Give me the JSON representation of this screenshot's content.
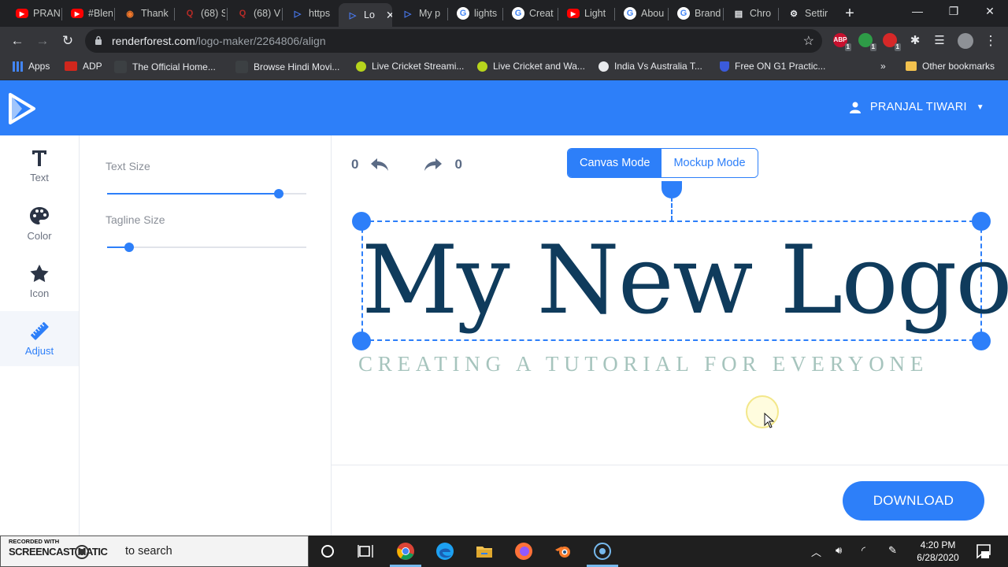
{
  "browser": {
    "tabs": [
      {
        "label": "PRAN",
        "icon": "youtube-icon",
        "color": "#ff0000"
      },
      {
        "label": "#Blen",
        "icon": "youtube-icon",
        "color": "#ff0000"
      },
      {
        "label": "Thank",
        "icon": "blender-icon",
        "color": "#f5792a"
      },
      {
        "label": "(68) S",
        "icon": "quora-icon",
        "color": "#b92b27"
      },
      {
        "label": "(68) V",
        "icon": "quora-icon",
        "color": "#b92b27"
      },
      {
        "label": "https",
        "icon": "renderforest-icon",
        "color": "#4a7cf7"
      },
      {
        "label": "Lo",
        "icon": "renderforest-icon",
        "color": "#4a7cf7"
      },
      {
        "label": "My p",
        "icon": "renderforest-icon",
        "color": "#4a7cf7"
      },
      {
        "label": "lights",
        "icon": "google-icon",
        "color": "#ffffff"
      },
      {
        "label": "Creat",
        "icon": "google-icon",
        "color": "#ffffff"
      },
      {
        "label": "Light",
        "icon": "youtube-icon",
        "color": "#ff0000"
      },
      {
        "label": "Abou",
        "icon": "google-icon",
        "color": "#ffffff"
      },
      {
        "label": "Brand",
        "icon": "google-icon",
        "color": "#ffffff"
      },
      {
        "label": "Chro",
        "icon": "store-icon",
        "color": "#e8eaed"
      },
      {
        "label": "Settir",
        "icon": "settings-gear-icon",
        "color": "#e8eaed"
      }
    ],
    "active_tab_index": 6,
    "url_domain": "renderforest.com",
    "url_path": "/logo-maker/2264806/align",
    "bookmarks": [
      {
        "label": "Apps",
        "icon": "apps-grid-icon"
      },
      {
        "label": "ADP",
        "icon": "adp-icon"
      },
      {
        "label": "The Official Home...",
        "icon": "site-icon"
      },
      {
        "label": "Browse Hindi Movi...",
        "icon": "site-icon"
      },
      {
        "label": "Live Cricket Streami...",
        "icon": "cricket-ball-icon"
      },
      {
        "label": "Live Cricket and Wa...",
        "icon": "cricket-ball-icon"
      },
      {
        "label": "India Vs Australia T...",
        "icon": "globe-icon"
      },
      {
        "label": "Free ON G1 Practic...",
        "icon": "shield-icon"
      }
    ],
    "more_bookmarks": "»",
    "other_bookmarks": "Other bookmarks",
    "extensions": [
      {
        "label": "ABP",
        "badge": "1",
        "color": "#c8102e"
      },
      {
        "label": "",
        "badge": "1",
        "color": "#2e9c47"
      },
      {
        "label": "",
        "badge": "1",
        "color": "#d62828"
      }
    ]
  },
  "app": {
    "brand_color": "#2d7ff9",
    "user_name": "PRANJAL TIWARI",
    "tools": [
      {
        "label": "Text",
        "icon": "text-t-icon"
      },
      {
        "label": "Color",
        "icon": "palette-icon"
      },
      {
        "label": "Icon",
        "icon": "star-icon"
      },
      {
        "label": "Adjust",
        "icon": "ruler-icon"
      }
    ],
    "active_tool_index": 3,
    "sliders": [
      {
        "label": "Text Size",
        "value": 0.86
      },
      {
        "label": "Tagline Size",
        "value": 0.11
      }
    ],
    "history": {
      "undo_count": "0",
      "redo_count": "0"
    },
    "modes": {
      "canvas": "Canvas Mode",
      "mockup": "Mockup Mode",
      "active": "canvas"
    },
    "logo": {
      "title": "My New Logo",
      "title_color": "#0f3b5c",
      "tagline": "CREATING A TUTORIAL FOR EVERYONE",
      "tagline_color": "#a6c4bd"
    },
    "download_label": "DOWNLOAD"
  },
  "taskbar": {
    "search_placeholder": "to search",
    "watermark_top": "RECORDED WITH",
    "watermark_brand": "SCREENCAST MATIC",
    "time": "4:20 PM",
    "date": "6/28/2020",
    "apps": [
      "cortana-icon",
      "task-view-icon",
      "chrome-icon",
      "edge-icon",
      "file-explorer-icon",
      "firefox-icon",
      "blender-icon",
      "screencast-icon"
    ]
  }
}
